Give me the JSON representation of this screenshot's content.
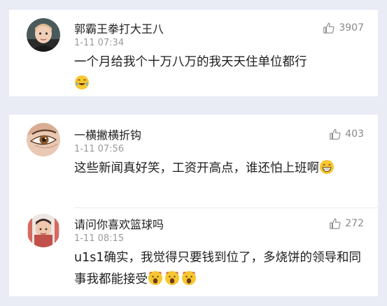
{
  "comments": [
    {
      "username": "郭霸王拳打大王八",
      "time": "1-11 07:34",
      "likes": "3907",
      "text": "一个月给我个十万八万的我天天住单位都行",
      "emoji": "crying-laughing-emoji"
    },
    {
      "username": "一横撇横折钩",
      "time": "1-11 07:56",
      "likes": "403",
      "text": "这些新闻真好笑，工资开高点，谁还怕上班啊",
      "emoji": "grinning-emoji"
    },
    {
      "username": "请问你喜欢篮球吗",
      "time": "1-11 08:15",
      "likes": "272",
      "text": "u1s1确实，我觉得只要钱到位了，多烧饼的领导和同事我都能接受",
      "emoji": "screaming-emoji"
    }
  ],
  "colors": {
    "background": "#e9ebf5",
    "card": "#ffffff",
    "username": "#1e1e1e",
    "meta": "#9a9a9a",
    "emoji": "#f7c72f"
  }
}
